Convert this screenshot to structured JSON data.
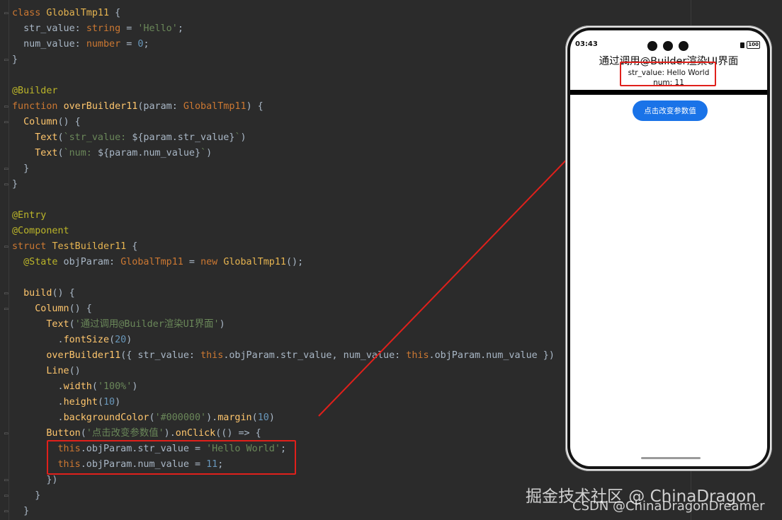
{
  "editor": {
    "lines": [
      [
        [
          "kw",
          "class "
        ],
        [
          "cls",
          "GlobalTmp11"
        ],
        [
          "id",
          " {"
        ]
      ],
      [
        [
          "id",
          "  str_value: "
        ],
        [
          "ty",
          "string"
        ],
        [
          "id",
          " = "
        ],
        [
          "str",
          "'Hello'"
        ],
        [
          "id",
          ";"
        ]
      ],
      [
        [
          "id",
          "  num_value: "
        ],
        [
          "ty",
          "number"
        ],
        [
          "id",
          " = "
        ],
        [
          "num",
          "0"
        ],
        [
          "id",
          ";"
        ]
      ],
      [
        [
          "id",
          "}"
        ]
      ],
      [],
      [
        [
          "dec",
          "@Builder"
        ]
      ],
      [
        [
          "kw",
          "function "
        ],
        [
          "fn",
          "overBuilder11"
        ],
        [
          "id",
          "(param: "
        ],
        [
          "ty",
          "GlobalTmp11"
        ],
        [
          "id",
          ") {"
        ]
      ],
      [
        [
          "id",
          "  "
        ],
        [
          "fn",
          "Column"
        ],
        [
          "id",
          "() {"
        ]
      ],
      [
        [
          "id",
          "    "
        ],
        [
          "fn",
          "Text"
        ],
        [
          "id",
          "("
        ],
        [
          "str",
          "`str_value: "
        ],
        [
          "id",
          "${param.str_value}"
        ],
        [
          "str",
          "`"
        ],
        [
          "id",
          ")"
        ]
      ],
      [
        [
          "id",
          "    "
        ],
        [
          "fn",
          "Text"
        ],
        [
          "id",
          "("
        ],
        [
          "str",
          "`num: "
        ],
        [
          "id",
          "${param.num_value}"
        ],
        [
          "str",
          "`"
        ],
        [
          "id",
          ")"
        ]
      ],
      [
        [
          "id",
          "  }"
        ]
      ],
      [
        [
          "id",
          "}"
        ]
      ],
      [],
      [
        [
          "dec",
          "@Entry"
        ]
      ],
      [
        [
          "dec",
          "@Component"
        ]
      ],
      [
        [
          "kw",
          "struct "
        ],
        [
          "cls",
          "TestBuilder11"
        ],
        [
          "id",
          " {"
        ]
      ],
      [
        [
          "id",
          "  "
        ],
        [
          "dec",
          "@State"
        ],
        [
          "id",
          " objParam: "
        ],
        [
          "ty",
          "GlobalTmp11"
        ],
        [
          "id",
          " = "
        ],
        [
          "kw",
          "new "
        ],
        [
          "cls",
          "GlobalTmp11"
        ],
        [
          "id",
          "();"
        ]
      ],
      [],
      [
        [
          "id",
          "  "
        ],
        [
          "fn",
          "build"
        ],
        [
          "id",
          "() {"
        ]
      ],
      [
        [
          "id",
          "    "
        ],
        [
          "fn",
          "Column"
        ],
        [
          "id",
          "() {"
        ]
      ],
      [
        [
          "id",
          "      "
        ],
        [
          "fn",
          "Text"
        ],
        [
          "id",
          "("
        ],
        [
          "str",
          "'通过调用@Builder渲染UI界面'"
        ],
        [
          "id",
          ")"
        ]
      ],
      [
        [
          "id",
          "        ."
        ],
        [
          "fn",
          "fontSize"
        ],
        [
          "id",
          "("
        ],
        [
          "num",
          "20"
        ],
        [
          "id",
          ")"
        ]
      ],
      [
        [
          "id",
          "      "
        ],
        [
          "fn",
          "overBuilder11"
        ],
        [
          "id",
          "({ str_value: "
        ],
        [
          "kw",
          "this"
        ],
        [
          "id",
          ".objParam.str_value, num_value: "
        ],
        [
          "kw",
          "this"
        ],
        [
          "id",
          ".objParam.num_value })"
        ]
      ],
      [
        [
          "id",
          "      "
        ],
        [
          "fn",
          "Line"
        ],
        [
          "id",
          "()"
        ]
      ],
      [
        [
          "id",
          "        ."
        ],
        [
          "fn",
          "width"
        ],
        [
          "id",
          "("
        ],
        [
          "str",
          "'100%'"
        ],
        [
          "id",
          ")"
        ]
      ],
      [
        [
          "id",
          "        ."
        ],
        [
          "fn",
          "height"
        ],
        [
          "id",
          "("
        ],
        [
          "num",
          "10"
        ],
        [
          "id",
          ")"
        ]
      ],
      [
        [
          "id",
          "        ."
        ],
        [
          "fn",
          "backgroundColor"
        ],
        [
          "id",
          "("
        ],
        [
          "str",
          "'#000000'"
        ],
        [
          "id",
          ")."
        ],
        [
          "fn",
          "margin"
        ],
        [
          "id",
          "("
        ],
        [
          "num",
          "10"
        ],
        [
          "id",
          ")"
        ]
      ],
      [
        [
          "id",
          "      "
        ],
        [
          "fn",
          "Button"
        ],
        [
          "id",
          "("
        ],
        [
          "str",
          "'点击改变参数值'"
        ],
        [
          "id",
          ")."
        ],
        [
          "fn",
          "onClick"
        ],
        [
          "id",
          "(() => {"
        ]
      ],
      [
        [
          "id",
          "        "
        ],
        [
          "kw",
          "this"
        ],
        [
          "id",
          ".objParam.str_value = "
        ],
        [
          "str",
          "'Hello World'"
        ],
        [
          "id",
          ";"
        ]
      ],
      [
        [
          "id",
          "        "
        ],
        [
          "kw",
          "this"
        ],
        [
          "id",
          ".objParam.num_value = "
        ],
        [
          "num",
          "11"
        ],
        [
          "id",
          ";"
        ]
      ],
      [
        [
          "id",
          "      })"
        ]
      ],
      [
        [
          "id",
          "    }"
        ]
      ],
      [
        [
          "id",
          "  }"
        ]
      ]
    ]
  },
  "phone": {
    "status_time": "03:43",
    "battery": "100",
    "app_title": "通过调用@Builder渲染UI界面",
    "str_line": "str_value: Hello World",
    "num_line": "num: 11",
    "button_label": "点击改变参数值"
  },
  "watermark": {
    "juejin": "掘金技术社区 @ ChinaDragon",
    "csdn": "CSDN @ChinaDragonDreamer"
  },
  "colors": {
    "editor_bg": "#2b2b2b",
    "highlight_box": "#e0201b",
    "button_blue": "#1a73e8"
  }
}
